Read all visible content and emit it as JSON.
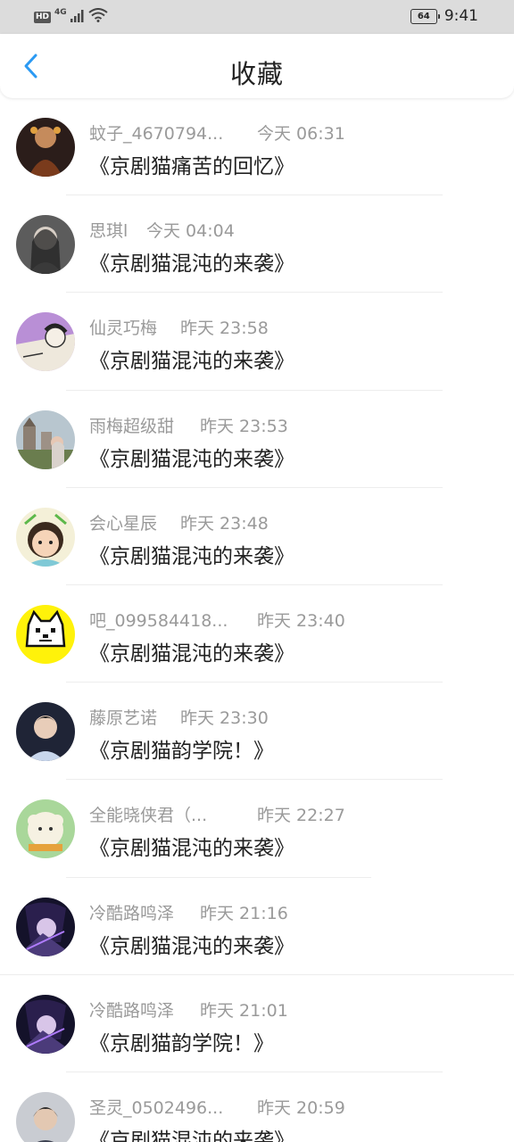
{
  "status_bar": {
    "hd": "HD",
    "network": "4G",
    "battery": "64",
    "time": "9:41"
  },
  "header": {
    "title": "收藏",
    "back_icon": "chevron-left-icon",
    "accent": "#2b9af3"
  },
  "favorites": [
    {
      "user": "蚊子_4670794...",
      "time": "今天 06:31",
      "title": "《京剧猫痛苦的回忆》"
    },
    {
      "user": "思琪l",
      "time": "今天 04:04",
      "title": "《京剧猫混沌的来袭》"
    },
    {
      "user": "仙灵巧梅",
      "time": "昨天 23:58",
      "title": "《京剧猫混沌的来袭》"
    },
    {
      "user": "雨梅超级甜",
      "time": "昨天 23:53",
      "title": "《京剧猫混沌的来袭》"
    },
    {
      "user": "会心星辰",
      "time": "昨天 23:48",
      "title": "《京剧猫混沌的来袭》"
    },
    {
      "user": "吧_099584418...",
      "time": "昨天 23:40",
      "title": "《京剧猫混沌的来袭》"
    },
    {
      "user": "藤原艺诺",
      "time": "昨天 23:30",
      "title": "《京剧猫韵学院！》"
    },
    {
      "user": "全能晓侠君（...",
      "time": "昨天 22:27",
      "title": "《京剧猫混沌的来袭》"
    },
    {
      "user": "冷酷路鸣泽",
      "time": "昨天 21:16",
      "title": "《京剧猫混沌的来袭》"
    },
    {
      "user": "冷酷路鸣泽",
      "time": "昨天 21:01",
      "title": "《京剧猫韵学院！》"
    },
    {
      "user": "圣灵_0502496...",
      "time": "昨天 20:59",
      "title": "《京剧猫混沌的来袭》"
    }
  ]
}
